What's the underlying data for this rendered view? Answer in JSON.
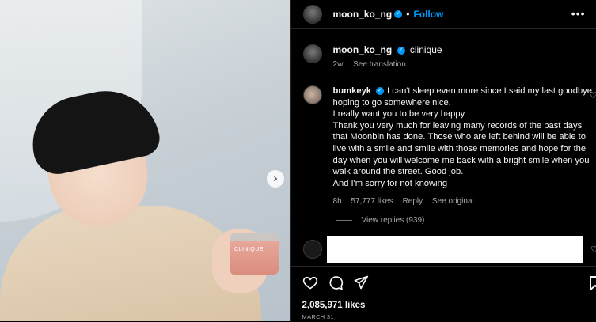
{
  "post": {
    "username": "moon_ko_ng",
    "follow_label": "Follow",
    "next_icon": "chevron-right-icon",
    "caption": {
      "username": "moon_ko_ng",
      "text": "clinique",
      "age": "2w",
      "see_translation": "See translation"
    },
    "jar_label": "CLINIQUE",
    "likes": "2,085,971 likes",
    "date": "MARCH 31"
  },
  "comment": {
    "username": "bumkeyk",
    "lines": [
      "I can't sleep even more since I said my last goodbye hoping to go somewhere nice.",
      "I really want you to be very happy",
      "Thank you very much for leaving many records of the past days that Moonbin has done. Those who are left behind will be able to live with a smile and smile with those memories and hope for the day when you will welcome me back with a bright smile when you walk around the street. Good job.",
      "And I'm sorry for not knowing"
    ],
    "age": "8h",
    "likes": "57,777 likes",
    "reply_label": "Reply",
    "see_original": "See original",
    "view_replies": "View replies (939)"
  },
  "colors": {
    "accent": "#0095f6",
    "background": "#000000",
    "muted_text": "#a8a8a8"
  }
}
